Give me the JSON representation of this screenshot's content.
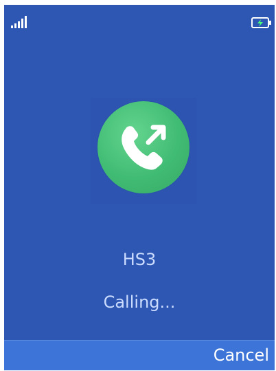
{
  "status_bar": {
    "signal_icon": "signal-strength-icon",
    "battery_icon": "battery-charging-icon"
  },
  "call": {
    "icon": "outgoing-call-icon",
    "contact_name": "HS3",
    "status": "Calling..."
  },
  "softkeys": {
    "right_label": "Cancel"
  },
  "colors": {
    "background": "#2d57b3",
    "call_accent": "#41bc74",
    "softkey_bar": "#3d74d8",
    "text": "#cbdcff"
  }
}
